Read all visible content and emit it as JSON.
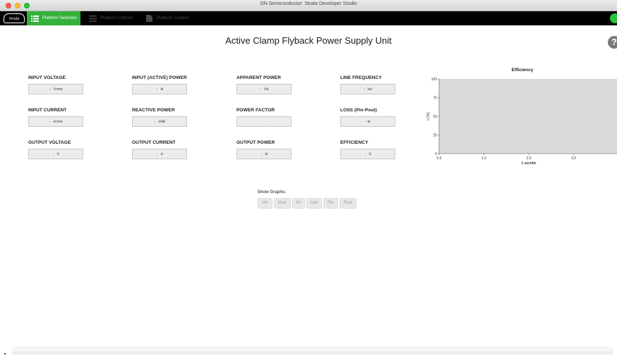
{
  "window": {
    "title": "ON Semiconductor: Strata Developer Studio"
  },
  "navbar": {
    "logo_text": "Strata",
    "tabs": [
      {
        "label": "Platform Selection",
        "active": true,
        "icon": "list-icon"
      },
      {
        "label": "Platform Controls",
        "active": false,
        "icon": "sliders-icon"
      },
      {
        "label": "Platform Content",
        "active": false,
        "icon": "document-icon"
      }
    ]
  },
  "page": {
    "title": "Active Clamp Flyback Power Supply Unit",
    "help_icon": "?"
  },
  "metrics": [
    {
      "label": "INPUT VOLTAGE",
      "value": "- Vrms"
    },
    {
      "label": "INPUT (ACTIVE) POWER",
      "value": "- W"
    },
    {
      "label": "APPARENT POWER",
      "value": "- VA"
    },
    {
      "label": "LINE FREQUENCY",
      "value": "- Hz"
    },
    {
      "label": "INPUT CURRENT",
      "value": "- Arms"
    },
    {
      "label": "REACTIVE POWER",
      "value": "- VAR"
    },
    {
      "label": "POWER FACTOR",
      "value": "-"
    },
    {
      "label": "LOSS (Pin-Pout)",
      "value": "-W"
    },
    {
      "label": "OUTPUT VOLTAGE",
      "value": "- V"
    },
    {
      "label": "OUTPUT CURRENT",
      "value": "- A"
    },
    {
      "label": "OUTPUT POWER",
      "value": "- W"
    },
    {
      "label": "EFFICIENCY",
      "value": "- %"
    }
  ],
  "chart_data": {
    "type": "line",
    "title": "Efficiency",
    "xlabel": "1 sec/div",
    "ylabel": "η [%]",
    "xlim": [
      0,
      4
    ],
    "ylim": [
      0,
      100
    ],
    "x_ticks": [
      "0.0",
      "1.0",
      "2.0",
      "3.0"
    ],
    "y_ticks": [
      "0",
      "25",
      "50",
      "75",
      "100"
    ],
    "series": [],
    "plot_background": "#d9d9d9"
  },
  "show_graphs": {
    "label": "Show Graphs:",
    "buttons": [
      "Vin",
      "Vout",
      "Iin",
      "Iout",
      "Pin",
      "Pout"
    ]
  },
  "colors": {
    "accent_green": "#33b13a",
    "navbar": "#000000",
    "status_dot": "#2ac23e"
  }
}
